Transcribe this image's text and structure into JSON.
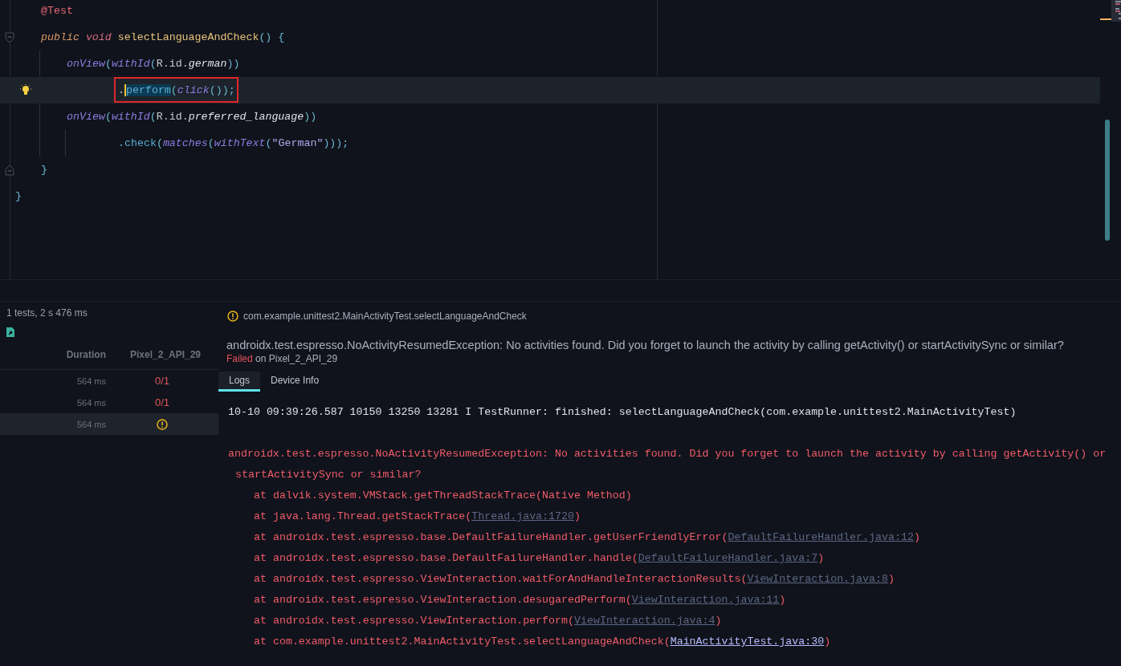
{
  "editor": {
    "lines": [
      {
        "tokens": [
          {
            "text": "@Test",
            "kind": "annotation"
          }
        ]
      },
      {
        "fold_start": true,
        "tokens": [
          {
            "text": "public",
            "kind": "modifier"
          },
          {
            "text": "void",
            "kind": "type"
          },
          {
            "text": "selectLanguageAndCheck",
            "kind": "method-def"
          },
          {
            "text": "() {",
            "kind": "punct"
          }
        ],
        "children": [
          {
            "tokens": [
              {
                "text": "onView",
                "kind": "call"
              },
              {
                "text": "(",
                "kind": "punct"
              },
              {
                "text": "withId",
                "kind": "call"
              },
              {
                "text": "(",
                "kind": "punct"
              },
              {
                "text": "R.id.",
                "kind": "plain"
              },
              {
                "text": "german",
                "kind": "field"
              },
              {
                "text": "))",
                "kind": "punct"
              }
            ],
            "children": [
              {
                "kind": "continuation",
                "current": true,
                "intention": true,
                "boxed": true,
                "tokens": [
                  {
                    "text": ".",
                    "kind": "plain"
                  },
                  {
                    "text": "perform",
                    "kind": "selected",
                    "caret": true
                  },
                  {
                    "text": "(",
                    "kind": "punct"
                  },
                  {
                    "text": "click",
                    "kind": "call"
                  },
                  {
                    "text": "());",
                    "kind": "punct"
                  }
                ]
              }
            ]
          },
          {
            "tokens": [
              {
                "text": "onView",
                "kind": "call"
              },
              {
                "text": "(",
                "kind": "punct"
              },
              {
                "text": "withId",
                "kind": "call"
              },
              {
                "text": "(",
                "kind": "punct"
              },
              {
                "text": "R.id.",
                "kind": "plain"
              },
              {
                "text": "preferred_language",
                "kind": "field"
              },
              {
                "text": "))",
                "kind": "punct"
              }
            ],
            "children": [
              {
                "kind": "continuation",
                "tokens": [
                  {
                    "text": ".check",
                    "kind": "member"
                  },
                  {
                    "text": "(",
                    "kind": "punct"
                  },
                  {
                    "text": "matches",
                    "kind": "call"
                  },
                  {
                    "text": "(",
                    "kind": "punct"
                  },
                  {
                    "text": "withText",
                    "kind": "call"
                  },
                  {
                    "text": "(",
                    "kind": "punct"
                  },
                  {
                    "text": "\"German\"",
                    "kind": "string"
                  },
                  {
                    "text": ")));",
                    "kind": "punct"
                  }
                ]
              }
            ]
          }
        ]
      },
      {
        "fold_end": true,
        "tokens": [
          {
            "text": "}",
            "kind": "punct"
          }
        ]
      }
    ],
    "trailing": [
      {
        "tokens": [
          {
            "text": "}",
            "kind": "punct"
          }
        ]
      }
    ]
  },
  "results": {
    "summary": "1 tests, 2 s 476 ms",
    "columns": [
      "Duration",
      "Pixel_2_API_29"
    ],
    "rows": [
      {
        "duration": "564 ms",
        "result": {
          "kind": "fail",
          "text": "0/1"
        },
        "selected": false
      },
      {
        "duration": "564 ms",
        "result": {
          "kind": "fail",
          "text": "0/1"
        },
        "selected": false
      },
      {
        "duration": "564 ms",
        "result": {
          "kind": "warning"
        },
        "selected": true
      }
    ]
  },
  "detail": {
    "test_name": "com.example.unittest2.MainActivityTest.selectLanguageAndCheck",
    "exception": "androidx.test.espresso.NoActivityResumedException: No activities found. Did you forget to launch the activity by calling getActivity() or startActivitySync or similar?",
    "status": "Failed",
    "device_note": "on Pixel_2_API_29",
    "tabs": [
      {
        "label": "Logs",
        "selected": true
      },
      {
        "label": "Device Info",
        "selected": false
      }
    ],
    "log": [
      {
        "kind": "info",
        "segments": [
          {
            "text": "10-10 09:39:26.587 10150 13250 13281 I TestRunner: finished: selectLanguageAndCheck(com.example.unittest2.MainActivityTest)"
          }
        ]
      },
      {
        "kind": "blank"
      },
      {
        "kind": "error",
        "segments": [
          {
            "text": "androidx.test.espresso.NoActivityResumedException: No activities found. Did you forget to launch the activity by calling getActivity() or startActivitySync or similar?"
          }
        ]
      },
      {
        "kind": "frame",
        "segments": [
          {
            "text": "at dalvik.system.VMStack.getThreadStackTrace(Native Method)"
          }
        ]
      },
      {
        "kind": "frame",
        "segments": [
          {
            "text": "at java.lang.Thread.getStackTrace("
          },
          {
            "text": "Thread.java:1720",
            "kind": "link"
          },
          {
            "text": ")"
          }
        ]
      },
      {
        "kind": "frame",
        "segments": [
          {
            "text": "at androidx.test.espresso.base.DefaultFailureHandler.getUserFriendlyError("
          },
          {
            "text": "DefaultFailureHandler.java:12",
            "kind": "link"
          },
          {
            "text": ")"
          }
        ]
      },
      {
        "kind": "frame",
        "segments": [
          {
            "text": "at androidx.test.espresso.base.DefaultFailureHandler.handle("
          },
          {
            "text": "DefaultFailureHandler.java:7",
            "kind": "link"
          },
          {
            "text": ")"
          }
        ]
      },
      {
        "kind": "frame",
        "segments": [
          {
            "text": "at androidx.test.espresso.ViewInteraction.waitForAndHandleInteractionResults("
          },
          {
            "text": "ViewInteraction.java:8",
            "kind": "link"
          },
          {
            "text": ")"
          }
        ]
      },
      {
        "kind": "frame",
        "segments": [
          {
            "text": "at androidx.test.espresso.ViewInteraction.desugaredPerform("
          },
          {
            "text": "ViewInteraction.java:11",
            "kind": "link"
          },
          {
            "text": ")"
          }
        ]
      },
      {
        "kind": "frame",
        "segments": [
          {
            "text": "at androidx.test.espresso.ViewInteraction.perform("
          },
          {
            "text": "ViewInteraction.java:4",
            "kind": "link"
          },
          {
            "text": ")"
          }
        ]
      },
      {
        "kind": "frame",
        "segments": [
          {
            "text": "at com.example.unittest2.MainActivityTest.selectLanguageAndCheck("
          },
          {
            "text": "MainActivityTest.java:30",
            "kind": "link-project"
          },
          {
            "text": ")"
          }
        ]
      }
    ]
  }
}
